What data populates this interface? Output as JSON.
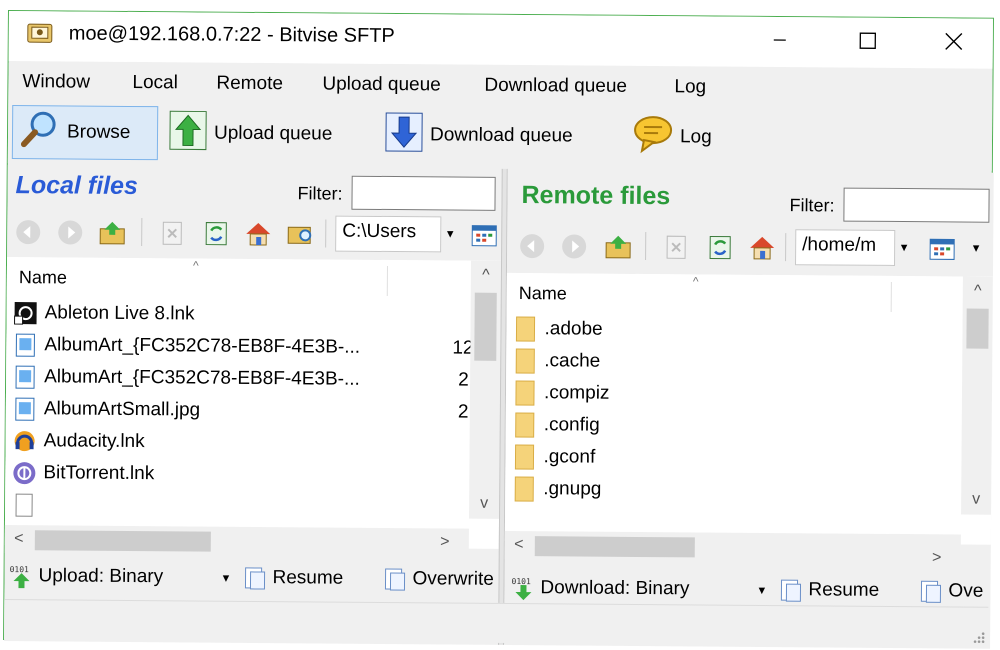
{
  "window": {
    "title": "moe@192.168.0.7:22 - Bitvise SFTP"
  },
  "menu": [
    "Window",
    "Local",
    "Remote",
    "Upload queue",
    "Download queue",
    "Log"
  ],
  "toolbar": {
    "browse_label": "Browse",
    "upload_queue_label": "Upload queue",
    "download_queue_label": "Download queue",
    "log_label": "Log"
  },
  "local": {
    "title": "Local files",
    "filter_label": "Filter:",
    "filter_value": "",
    "path": "C:\\Users",
    "column_name": "Name",
    "files": [
      {
        "name": "Ableton Live 8.lnk",
        "size": "",
        "icon": "ableton-icon"
      },
      {
        "name": "AlbumArt_{FC352C78-EB8F-4E3B-...",
        "size": "12",
        "icon": "image-file-icon"
      },
      {
        "name": "AlbumArt_{FC352C78-EB8F-4E3B-...",
        "size": "2",
        "icon": "image-file-icon"
      },
      {
        "name": "AlbumArtSmall.jpg",
        "size": "2",
        "icon": "image-file-icon"
      },
      {
        "name": "Audacity.lnk",
        "size": "",
        "icon": "audacity-icon"
      },
      {
        "name": "BitTorrent.lnk",
        "size": "",
        "icon": "bittorrent-icon"
      }
    ],
    "transfer_mode": "Upload: Binary",
    "resume_label": "Resume",
    "overwrite_label": "Overwrite"
  },
  "remote": {
    "title": "Remote files",
    "filter_label": "Filter:",
    "filter_value": "",
    "path": "/home/m",
    "column_name": "Name",
    "files": [
      {
        "name": ".adobe",
        "icon": "folder-icon"
      },
      {
        "name": ".cache",
        "icon": "folder-icon"
      },
      {
        "name": ".compiz",
        "icon": "folder-icon"
      },
      {
        "name": ".config",
        "icon": "folder-icon"
      },
      {
        "name": ".gconf",
        "icon": "folder-icon"
      },
      {
        "name": ".gnupg",
        "icon": "folder-icon"
      }
    ],
    "transfer_mode": "Download: Binary",
    "resume_label": "Resume",
    "overwrite_label": "Ove"
  },
  "colors": {
    "local_title": "#2a5bd7",
    "remote_title": "#2a9a3a",
    "folder": "#f5d37a",
    "window_border": "#4caf50"
  }
}
